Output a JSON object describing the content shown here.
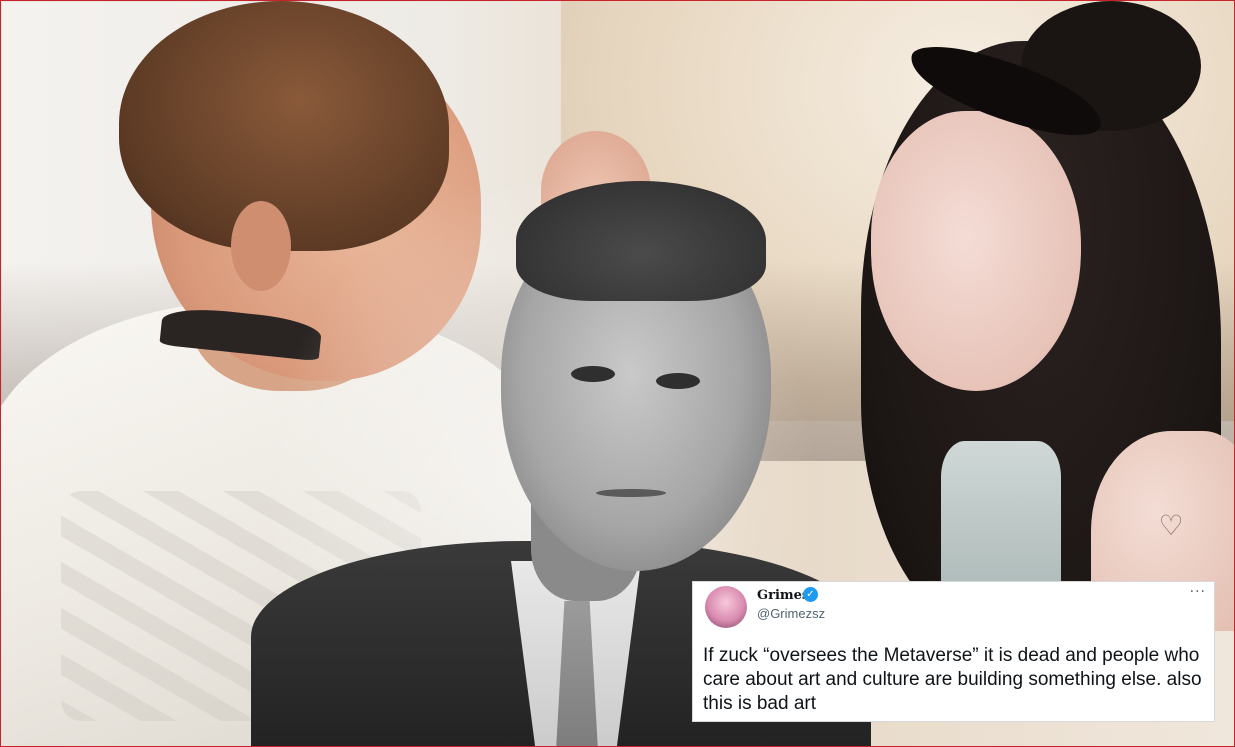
{
  "tweet": {
    "display_name": "Grimes",
    "handle": "@Grimezsz",
    "text": "If zuck “oversees the Metaverse” it is dead and people who care about art and culture are building something else. also this is bad art",
    "verified_icon": "check-badge-icon",
    "more_icon": "more-horizontal-icon",
    "more_glyph": "···",
    "verified_glyph": "✓"
  },
  "colors": {
    "frame_border": "#c7232a",
    "verified_blue": "#1d9bf0",
    "tweet_text": "#0f1419",
    "tweet_handle": "#536471"
  },
  "decor": {
    "heart_glyph": "♡"
  }
}
